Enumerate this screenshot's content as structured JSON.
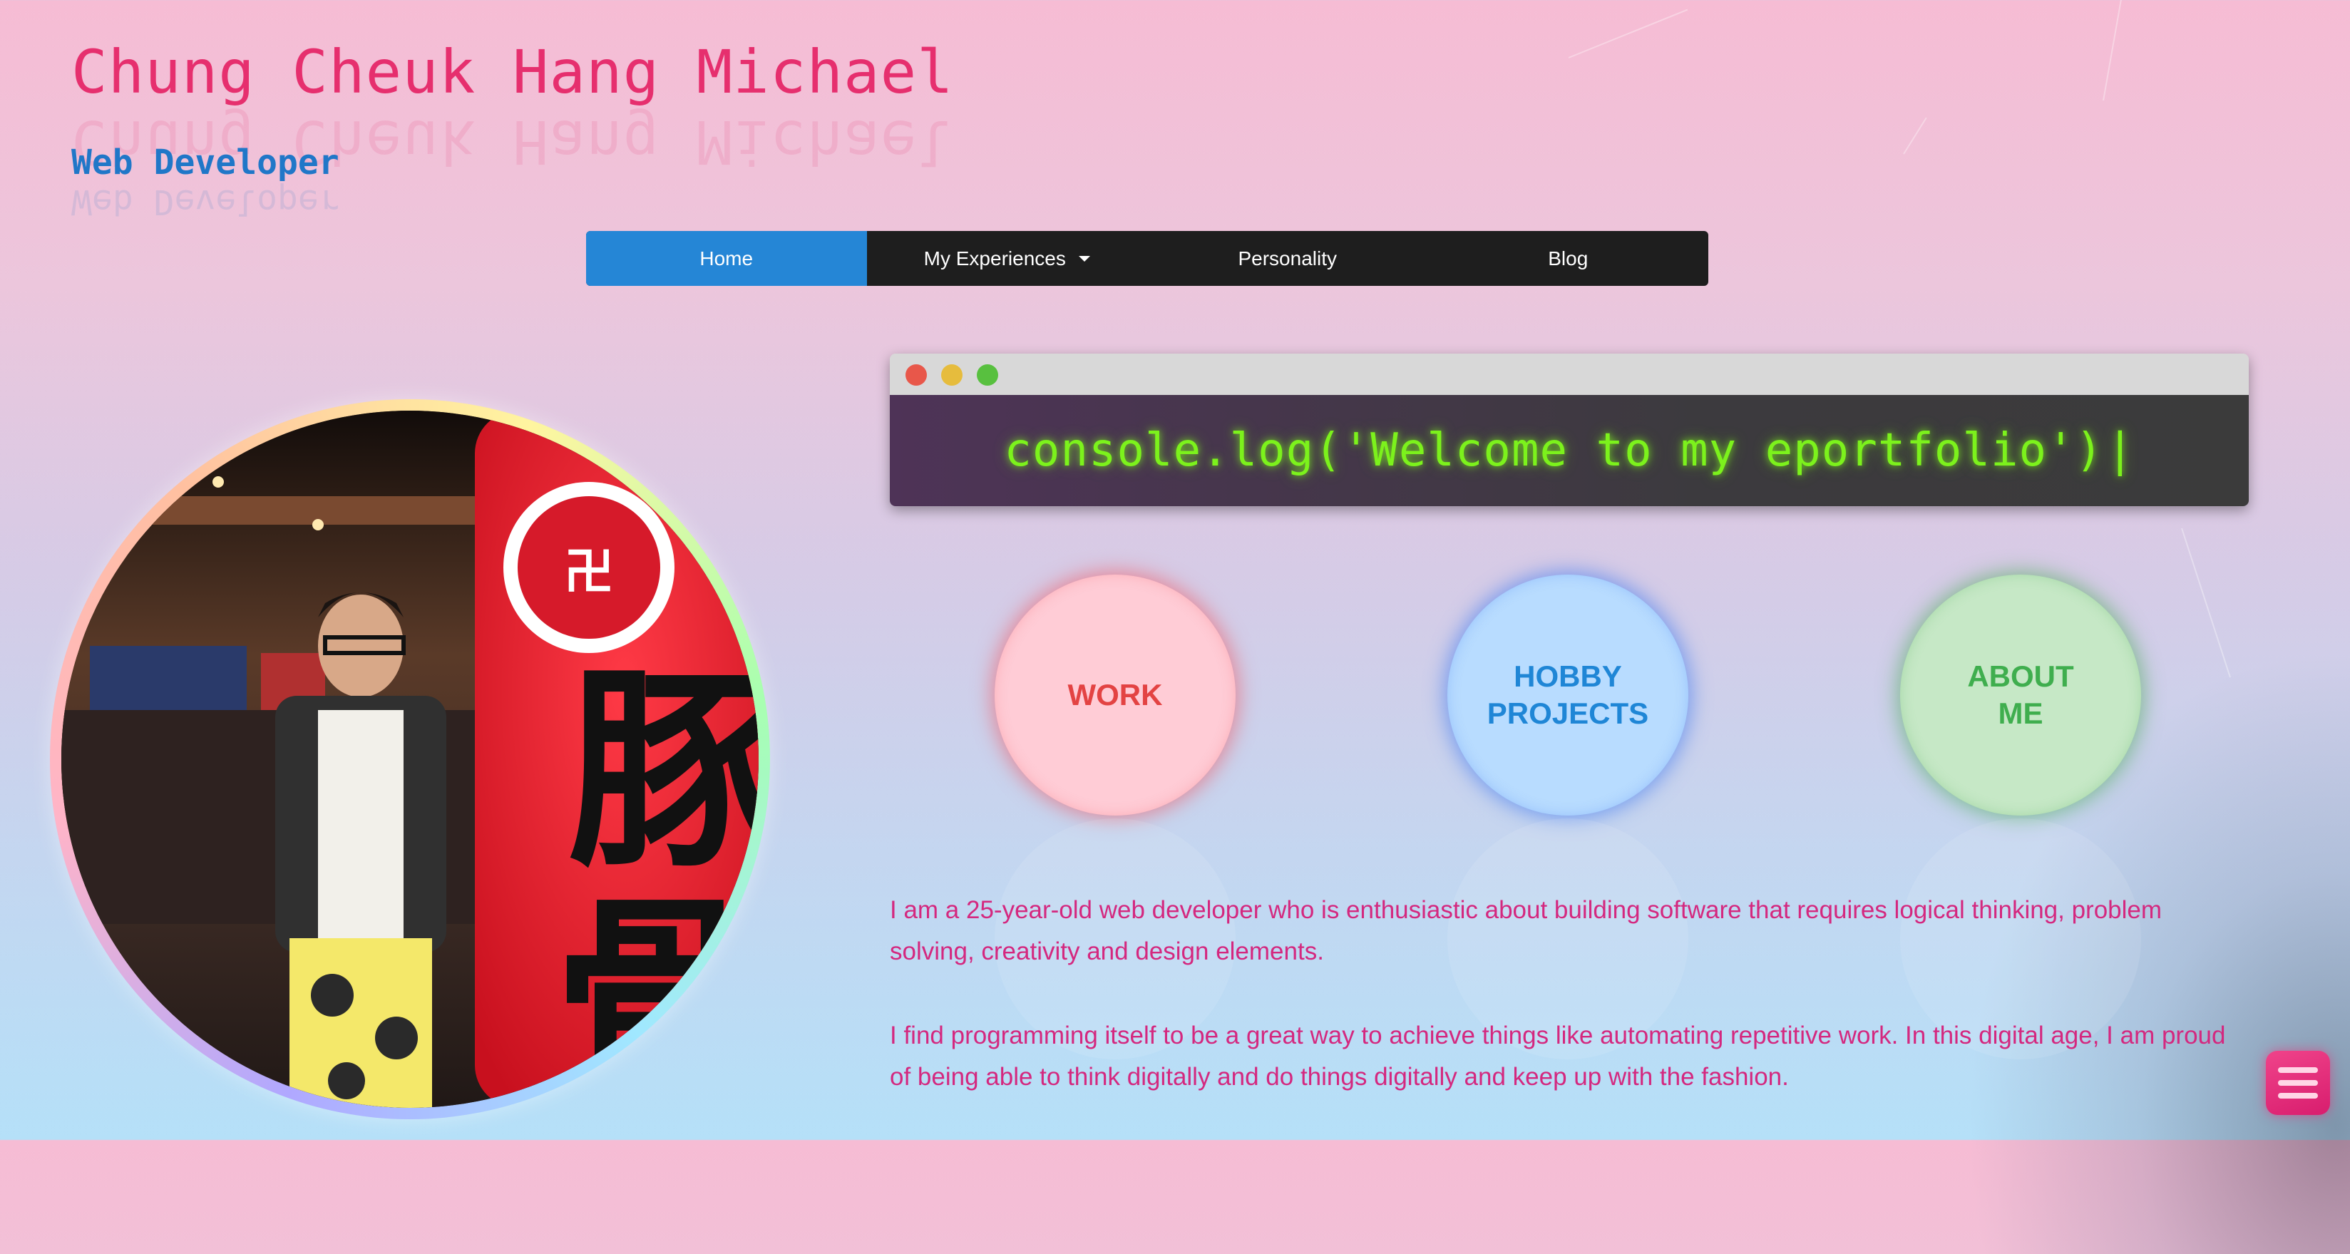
{
  "header": {
    "name": "Chung Cheuk Hang Michael",
    "role": "Web Developer"
  },
  "nav": {
    "items": [
      {
        "label": "Home",
        "active": true
      },
      {
        "label": "My Experiences",
        "dropdown": true
      },
      {
        "label": "Personality"
      },
      {
        "label": "Blog"
      }
    ]
  },
  "terminal": {
    "text": "console.log('Welcome to my eportfolio')",
    "cursor": "|",
    "dots": [
      "#e8574a",
      "#e6bc3d",
      "#58c03f"
    ]
  },
  "circles": {
    "work": "WORK",
    "hobby": "HOBBY\nPROJECTS",
    "about": "ABOUT\nME"
  },
  "intro": {
    "p1": "I am a 25-year-old web developer who is enthusiastic about building software that requires logical thinking, problem solving, creativity and design elements.",
    "p2": "I find programming itself to be a great way to achieve things like automating repetitive work. In this digital age, I am proud of being able to think digitally and do things digitally and keep up with the fashion."
  },
  "profile_photo": {
    "icon": "portrait-photo"
  },
  "menu_button": {
    "icon": "hamburger-menu-icon"
  },
  "colors": {
    "accent_pink": "#e62f6e",
    "accent_blue": "#2586d6",
    "terminal_green": "#7cf21c"
  }
}
